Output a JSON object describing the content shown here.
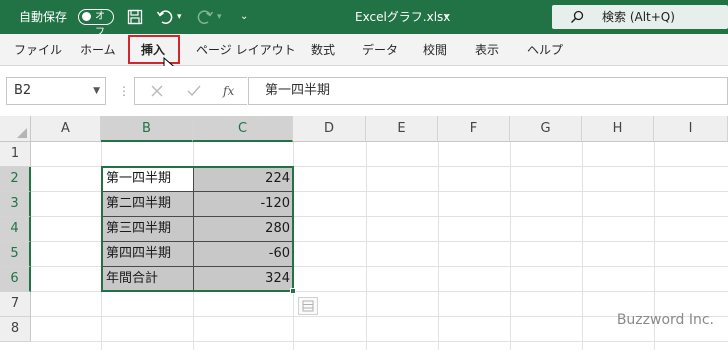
{
  "titlebar": {
    "autosave_label": "自動保存",
    "autosave_toggle": "オフ",
    "filename": "Excelグラフ.xlsx",
    "filename_caret": "▾",
    "search_label": "検索 (Alt+Q)"
  },
  "ribbon": {
    "tabs": [
      {
        "label": "ファイル"
      },
      {
        "label": "ホーム"
      },
      {
        "label": "挿入"
      },
      {
        "label": "ページ レイアウト"
      },
      {
        "label": "数式"
      },
      {
        "label": "データ"
      },
      {
        "label": "校閲"
      },
      {
        "label": "表示"
      },
      {
        "label": "ヘルプ"
      }
    ]
  },
  "formula_bar": {
    "name_box": "B2",
    "fx_symbol": "fx",
    "formula": "第一四半期"
  },
  "grid": {
    "columns": [
      "A",
      "B",
      "C",
      "D",
      "E",
      "F",
      "G",
      "H",
      "I"
    ],
    "rows": [
      "1",
      "2",
      "3",
      "4",
      "5",
      "6",
      "7",
      "8"
    ],
    "data": [
      {
        "label": "第一四半期",
        "value": "224"
      },
      {
        "label": "第二四半期",
        "value": "-120"
      },
      {
        "label": "第三四半期",
        "value": "280"
      },
      {
        "label": "第四四半期",
        "value": "-60"
      },
      {
        "label": "年間合計",
        "value": "324"
      }
    ]
  },
  "watermark": "Buzzword Inc.",
  "colors": {
    "excel_green": "#217346",
    "highlight_red": "#d0262d",
    "selection_fill": "#c8c8c8"
  }
}
